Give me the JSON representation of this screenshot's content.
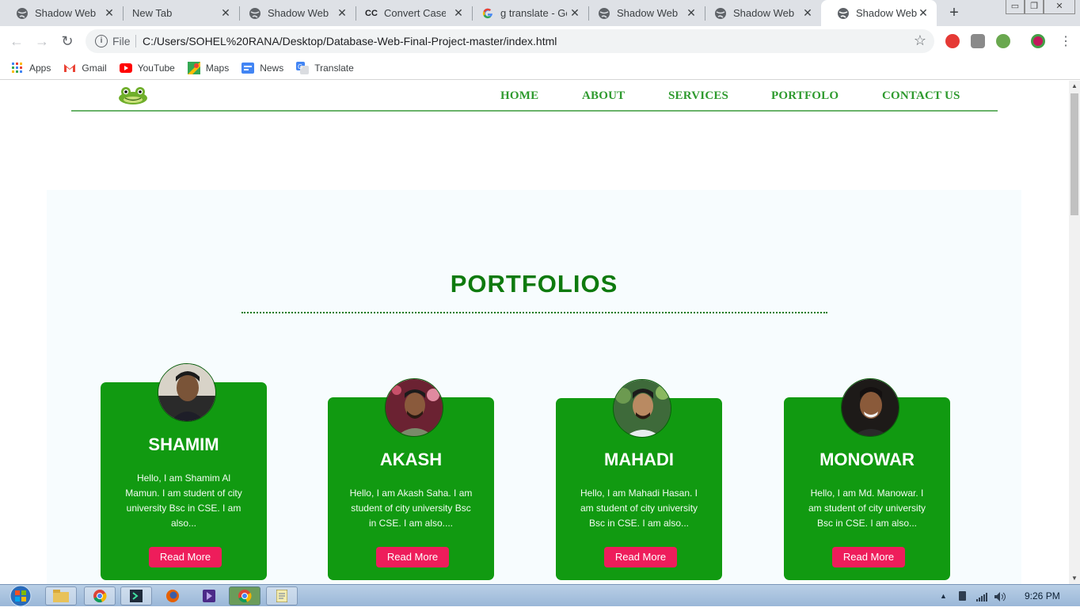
{
  "browser": {
    "tabs": [
      {
        "title": "Shadow Web",
        "icon": "globe-icon"
      },
      {
        "title": "New Tab",
        "icon": ""
      },
      {
        "title": "Shadow Web",
        "icon": "globe-icon"
      },
      {
        "title": "Convert Case - ",
        "icon": "cc-icon"
      },
      {
        "title": "g translate - Go",
        "icon": "google-icon"
      },
      {
        "title": "Shadow Web",
        "icon": "globe-icon"
      },
      {
        "title": "Shadow Web",
        "icon": "globe-icon"
      },
      {
        "title": "Shadow Web",
        "icon": "globe-icon"
      }
    ],
    "active_tab_index": 7,
    "omnibox": {
      "scheme_label": "File",
      "url": "C:/Users/SOHEL%20RANA/Desktop/Database-Web-Final-Project-master/index.html"
    },
    "bookmarks": [
      {
        "label": "Apps",
        "icon": "apps-grid-icon"
      },
      {
        "label": "Gmail",
        "icon": "gmail-icon"
      },
      {
        "label": "YouTube",
        "icon": "youtube-icon"
      },
      {
        "label": "Maps",
        "icon": "maps-icon"
      },
      {
        "label": "News",
        "icon": "news-icon"
      },
      {
        "label": "Translate",
        "icon": "translate-icon"
      }
    ],
    "cc_glyph": "CC"
  },
  "site": {
    "nav": [
      "HOME",
      "ABOUT",
      "SERVICES",
      "PORTFOLO",
      "CONTACT US"
    ],
    "section_title": "PORTFOLIOS",
    "accent_color": "#119a11",
    "button_color": "#ee1d5b",
    "cards": [
      {
        "name": "SHAMIM",
        "bio": "Hello, I am Shamim Al Mamun. I am student of city university Bsc in CSE. I am also...",
        "button": "Read More"
      },
      {
        "name": "AKASH",
        "bio": "Hello, I am Akash Saha. I am student of city university Bsc in CSE. I am also....",
        "button": "Read More"
      },
      {
        "name": "MAHADI",
        "bio": "Hello, I am Mahadi Hasan. I am student of city university Bsc in CSE. I am also...",
        "button": "Read More"
      },
      {
        "name": "MONOWAR",
        "bio": "Hello, I am Md. Manowar. I am student of city university Bsc in CSE. I am also...",
        "button": "Read More"
      }
    ]
  },
  "taskbar": {
    "clock": "9:26 PM"
  }
}
